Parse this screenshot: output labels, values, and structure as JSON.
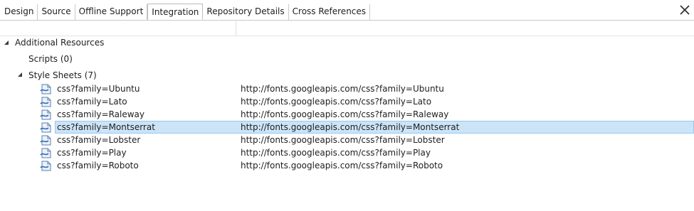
{
  "tabs": [
    {
      "label": "Design",
      "active": false
    },
    {
      "label": "Source",
      "active": false
    },
    {
      "label": "Offline Support",
      "active": false
    },
    {
      "label": "Integration",
      "active": true
    },
    {
      "label": "Repository Details",
      "active": false
    },
    {
      "label": "Cross References",
      "active": false
    }
  ],
  "close_icon": "close-icon",
  "tree": {
    "root": {
      "label": "Additional Resources",
      "expanded": true
    },
    "scripts": {
      "label": "Scripts (0)"
    },
    "stylesheets": {
      "label": "Style Sheets (7)",
      "expanded": true,
      "items": [
        {
          "name": "css?family=Ubuntu",
          "url": "http://fonts.googleapis.com/css?family=Ubuntu",
          "selected": false
        },
        {
          "name": "css?family=Lato",
          "url": "http://fonts.googleapis.com/css?family=Lato",
          "selected": false
        },
        {
          "name": "css?family=Raleway",
          "url": "http://fonts.googleapis.com/css?family=Raleway",
          "selected": false
        },
        {
          "name": "css?family=Montserrat",
          "url": "http://fonts.googleapis.com/css?family=Montserrat",
          "selected": true
        },
        {
          "name": "css?family=Lobster",
          "url": "http://fonts.googleapis.com/css?family=Lobster",
          "selected": false
        },
        {
          "name": "css?family=Play",
          "url": "http://fonts.googleapis.com/css?family=Play",
          "selected": false
        },
        {
          "name": "css?family=Roboto",
          "url": "http://fonts.googleapis.com/css?family=Roboto",
          "selected": false
        }
      ]
    }
  },
  "colors": {
    "selection_bg": "#cce4f7",
    "selection_border": "#99c9ef",
    "tab_border": "#c9c9c9"
  }
}
